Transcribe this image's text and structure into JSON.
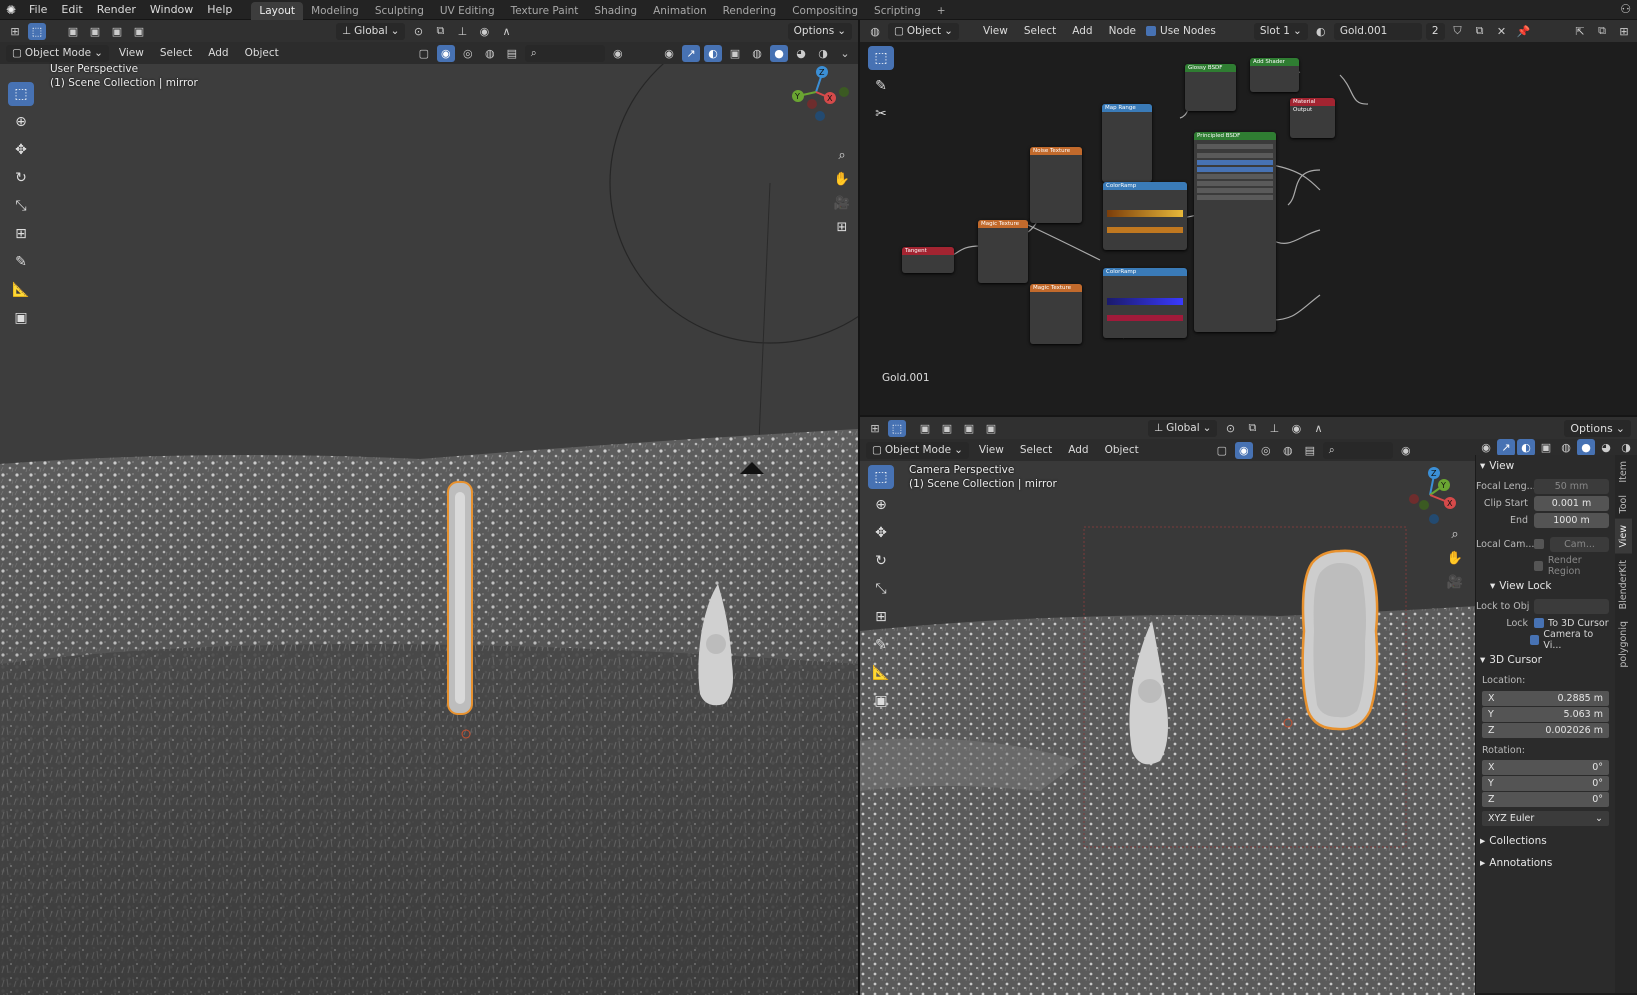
{
  "topbar": {
    "menus": [
      "File",
      "Edit",
      "Render",
      "Window",
      "Help"
    ],
    "workspaces": [
      "Layout",
      "Modeling",
      "Sculpting",
      "UV Editing",
      "Texture Paint",
      "Shading",
      "Animation",
      "Rendering",
      "Compositing",
      "Scripting"
    ],
    "active_workspace": "Layout",
    "plus": "+"
  },
  "left_viewport": {
    "orientation": "Global",
    "options": "Options",
    "mode": "Object Mode",
    "menus": [
      "View",
      "Select",
      "Add",
      "Object"
    ],
    "overlay_title": "User Perspective",
    "overlay_collection": "(1) Scene Collection | mirror",
    "gizmo": {
      "x": "X",
      "y": "Y",
      "z": "Z"
    }
  },
  "node_editor": {
    "type": "Object",
    "menus": [
      "View",
      "Select",
      "Add",
      "Node"
    ],
    "use_nodes_label": "Use Nodes",
    "use_nodes": true,
    "slot": "Slot 1",
    "material": "Gold.001",
    "users": "2",
    "footer_label": "Gold.001",
    "nodes": [
      {
        "title": "Glossy BSDF",
        "color": "#2f7d32"
      },
      {
        "title": "Add Shader",
        "color": "#2f7d32"
      },
      {
        "title": "Material Output",
        "color": "#a32431"
      },
      {
        "title": "Map Range",
        "color": "#3a7bb8"
      },
      {
        "title": "Noise Texture",
        "color": "#c26a2c"
      },
      {
        "title": "Principled BSDF",
        "color": "#2f7d32"
      },
      {
        "title": "ColorRamp",
        "color": "#3a7bb8"
      },
      {
        "title": "Magic Texture",
        "color": "#c26a2c"
      },
      {
        "title": "Tangent",
        "color": "#a32431"
      },
      {
        "title": "ColorRamp",
        "color": "#3a7bb8"
      },
      {
        "title": "Magic Texture",
        "color": "#c26a2c"
      }
    ]
  },
  "right_viewport": {
    "orientation": "Global",
    "options": "Options",
    "mode": "Object Mode",
    "menus": [
      "View",
      "Select",
      "Add",
      "Object"
    ],
    "overlay_title": "Camera Perspective",
    "overlay_collection": "(1) Scene Collection | mirror",
    "gizmo": {
      "x": "X",
      "y": "Y",
      "z": "Z"
    }
  },
  "sidebar": {
    "view_section": "View",
    "focal_length_label": "Focal Leng...",
    "focal_length": "50 mm",
    "clip_start_label": "Clip Start",
    "clip_start": "0.001 m",
    "clip_end_label": "End",
    "clip_end": "1000 m",
    "local_camera_label": "Local Cam...",
    "local_camera_value": "Cam...",
    "render_region": "Render Region",
    "view_lock_section": "View Lock",
    "lock_to_obj_label": "Lock to Obj",
    "lock_label": "Lock",
    "to_3d_cursor": "To 3D Cursor",
    "camera_to_view": "Camera to Vi...",
    "cursor_section": "3D Cursor",
    "location_label": "Location:",
    "loc_x": "0.2885 m",
    "loc_y": "5.063 m",
    "loc_z": "0.002026 m",
    "rotation_label": "Rotation:",
    "rot_x": "0°",
    "rot_y": "0°",
    "rot_z": "0°",
    "rotation_mode": "XYZ Euler",
    "collections_section": "Collections",
    "annotations_section": "Annotations",
    "tabs": [
      "Item",
      "Tool",
      "View",
      "BlenderKit",
      "polygoniq"
    ]
  },
  "axis_labels": {
    "x": "X",
    "y": "Y",
    "z": "Z"
  }
}
